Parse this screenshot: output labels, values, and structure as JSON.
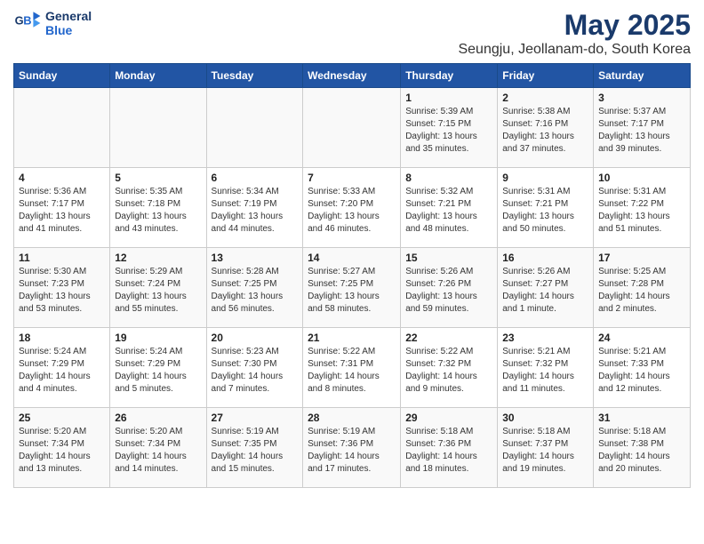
{
  "logo": {
    "line1": "General",
    "line2": "Blue"
  },
  "title": "May 2025",
  "location": "Seungju, Jeollanam-do, South Korea",
  "days_of_week": [
    "Sunday",
    "Monday",
    "Tuesday",
    "Wednesday",
    "Thursday",
    "Friday",
    "Saturday"
  ],
  "weeks": [
    [
      {
        "day": "",
        "info": ""
      },
      {
        "day": "",
        "info": ""
      },
      {
        "day": "",
        "info": ""
      },
      {
        "day": "",
        "info": ""
      },
      {
        "day": "1",
        "info": "Sunrise: 5:39 AM\nSunset: 7:15 PM\nDaylight: 13 hours\nand 35 minutes."
      },
      {
        "day": "2",
        "info": "Sunrise: 5:38 AM\nSunset: 7:16 PM\nDaylight: 13 hours\nand 37 minutes."
      },
      {
        "day": "3",
        "info": "Sunrise: 5:37 AM\nSunset: 7:17 PM\nDaylight: 13 hours\nand 39 minutes."
      }
    ],
    [
      {
        "day": "4",
        "info": "Sunrise: 5:36 AM\nSunset: 7:17 PM\nDaylight: 13 hours\nand 41 minutes."
      },
      {
        "day": "5",
        "info": "Sunrise: 5:35 AM\nSunset: 7:18 PM\nDaylight: 13 hours\nand 43 minutes."
      },
      {
        "day": "6",
        "info": "Sunrise: 5:34 AM\nSunset: 7:19 PM\nDaylight: 13 hours\nand 44 minutes."
      },
      {
        "day": "7",
        "info": "Sunrise: 5:33 AM\nSunset: 7:20 PM\nDaylight: 13 hours\nand 46 minutes."
      },
      {
        "day": "8",
        "info": "Sunrise: 5:32 AM\nSunset: 7:21 PM\nDaylight: 13 hours\nand 48 minutes."
      },
      {
        "day": "9",
        "info": "Sunrise: 5:31 AM\nSunset: 7:21 PM\nDaylight: 13 hours\nand 50 minutes."
      },
      {
        "day": "10",
        "info": "Sunrise: 5:31 AM\nSunset: 7:22 PM\nDaylight: 13 hours\nand 51 minutes."
      }
    ],
    [
      {
        "day": "11",
        "info": "Sunrise: 5:30 AM\nSunset: 7:23 PM\nDaylight: 13 hours\nand 53 minutes."
      },
      {
        "day": "12",
        "info": "Sunrise: 5:29 AM\nSunset: 7:24 PM\nDaylight: 13 hours\nand 55 minutes."
      },
      {
        "day": "13",
        "info": "Sunrise: 5:28 AM\nSunset: 7:25 PM\nDaylight: 13 hours\nand 56 minutes."
      },
      {
        "day": "14",
        "info": "Sunrise: 5:27 AM\nSunset: 7:25 PM\nDaylight: 13 hours\nand 58 minutes."
      },
      {
        "day": "15",
        "info": "Sunrise: 5:26 AM\nSunset: 7:26 PM\nDaylight: 13 hours\nand 59 minutes."
      },
      {
        "day": "16",
        "info": "Sunrise: 5:26 AM\nSunset: 7:27 PM\nDaylight: 14 hours\nand 1 minute."
      },
      {
        "day": "17",
        "info": "Sunrise: 5:25 AM\nSunset: 7:28 PM\nDaylight: 14 hours\nand 2 minutes."
      }
    ],
    [
      {
        "day": "18",
        "info": "Sunrise: 5:24 AM\nSunset: 7:29 PM\nDaylight: 14 hours\nand 4 minutes."
      },
      {
        "day": "19",
        "info": "Sunrise: 5:24 AM\nSunset: 7:29 PM\nDaylight: 14 hours\nand 5 minutes."
      },
      {
        "day": "20",
        "info": "Sunrise: 5:23 AM\nSunset: 7:30 PM\nDaylight: 14 hours\nand 7 minutes."
      },
      {
        "day": "21",
        "info": "Sunrise: 5:22 AM\nSunset: 7:31 PM\nDaylight: 14 hours\nand 8 minutes."
      },
      {
        "day": "22",
        "info": "Sunrise: 5:22 AM\nSunset: 7:32 PM\nDaylight: 14 hours\nand 9 minutes."
      },
      {
        "day": "23",
        "info": "Sunrise: 5:21 AM\nSunset: 7:32 PM\nDaylight: 14 hours\nand 11 minutes."
      },
      {
        "day": "24",
        "info": "Sunrise: 5:21 AM\nSunset: 7:33 PM\nDaylight: 14 hours\nand 12 minutes."
      }
    ],
    [
      {
        "day": "25",
        "info": "Sunrise: 5:20 AM\nSunset: 7:34 PM\nDaylight: 14 hours\nand 13 minutes."
      },
      {
        "day": "26",
        "info": "Sunrise: 5:20 AM\nSunset: 7:34 PM\nDaylight: 14 hours\nand 14 minutes."
      },
      {
        "day": "27",
        "info": "Sunrise: 5:19 AM\nSunset: 7:35 PM\nDaylight: 14 hours\nand 15 minutes."
      },
      {
        "day": "28",
        "info": "Sunrise: 5:19 AM\nSunset: 7:36 PM\nDaylight: 14 hours\nand 17 minutes."
      },
      {
        "day": "29",
        "info": "Sunrise: 5:18 AM\nSunset: 7:36 PM\nDaylight: 14 hours\nand 18 minutes."
      },
      {
        "day": "30",
        "info": "Sunrise: 5:18 AM\nSunset: 7:37 PM\nDaylight: 14 hours\nand 19 minutes."
      },
      {
        "day": "31",
        "info": "Sunrise: 5:18 AM\nSunset: 7:38 PM\nDaylight: 14 hours\nand 20 minutes."
      }
    ]
  ]
}
